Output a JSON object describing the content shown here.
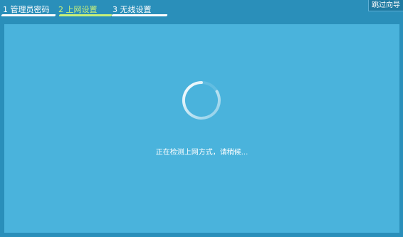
{
  "wizard": {
    "steps": [
      {
        "label": "1 管理员密码",
        "state": "done"
      },
      {
        "label": "2 上网设置",
        "state": "active"
      },
      {
        "label": "3 无线设置",
        "state": "pending"
      }
    ],
    "skip_label": "跳过向导"
  },
  "main": {
    "status_text": "正在检测上网方式，请稍候...",
    "spinner_icon": "loading-spinner-icon"
  },
  "colors": {
    "background": "#2a8fba",
    "panel": "#4ab3dc",
    "active_step": "#c8f07a",
    "text": "#ffffff"
  }
}
